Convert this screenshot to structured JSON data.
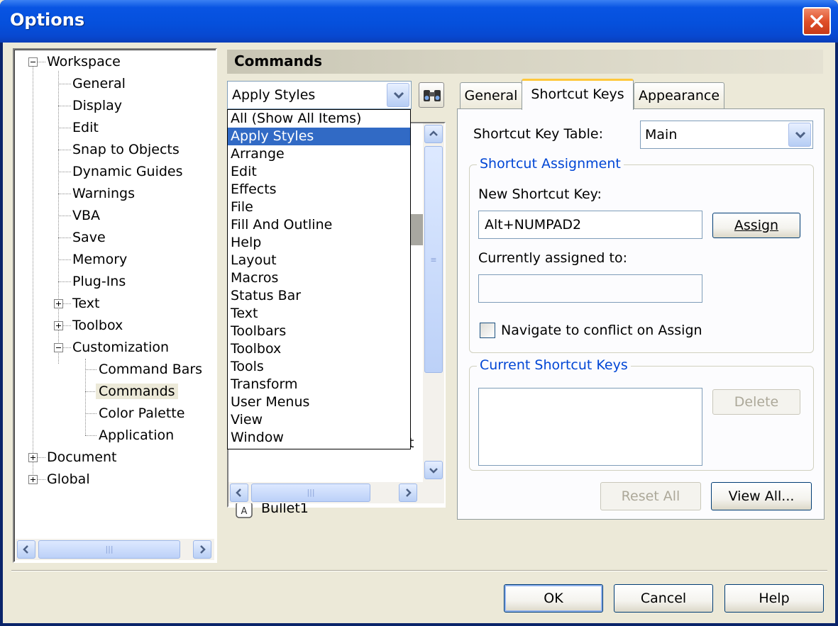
{
  "window": {
    "title": "Options"
  },
  "tree": {
    "items": [
      {
        "label": "Workspace"
      },
      {
        "label": "General"
      },
      {
        "label": "Display"
      },
      {
        "label": "Edit"
      },
      {
        "label": "Snap to Objects"
      },
      {
        "label": "Dynamic Guides"
      },
      {
        "label": "Warnings"
      },
      {
        "label": "VBA"
      },
      {
        "label": "Save"
      },
      {
        "label": "Memory"
      },
      {
        "label": "Plug-Ins"
      },
      {
        "label": "Text"
      },
      {
        "label": "Toolbox"
      },
      {
        "label": "Customization"
      },
      {
        "label": "Command Bars"
      },
      {
        "label": "Commands"
      },
      {
        "label": "Color Palette"
      },
      {
        "label": "Application"
      },
      {
        "label": "Document"
      },
      {
        "label": "Global"
      }
    ]
  },
  "commands": {
    "header": "Commands",
    "category_value": "Apply Styles",
    "dropdown_options": [
      "All (Show All Items)",
      "Apply Styles",
      "Arrange",
      "Edit",
      "Effects",
      "File",
      "Fill And Outline",
      "Help",
      "Layout",
      "Macros",
      "Status Bar",
      "Text",
      "Toolbars",
      "Toolbox",
      "Tools",
      "Transform",
      "User Menus",
      "View",
      "Window"
    ],
    "list_item_partial": "t",
    "list_item": "Bullet1"
  },
  "tabs": [
    "General",
    "Shortcut Keys",
    "Appearance"
  ],
  "shortcut": {
    "table_label": "Shortcut Key Table:",
    "table_value": "Main",
    "assignment_title": "Shortcut Assignment",
    "new_key_label": "New Shortcut Key:",
    "new_key_value": "Alt+NUMPAD2",
    "assign_button": "Assign",
    "assigned_to_label": "Currently assigned to:",
    "assigned_to_value": "",
    "navigate_label": "Navigate to conflict on Assign",
    "current_keys_title": "Current Shortcut Keys",
    "delete_button": "Delete",
    "reset_all_button": "Reset All",
    "view_all_button": "View All..."
  },
  "footer": {
    "ok": "OK",
    "cancel": "Cancel",
    "help": "Help"
  }
}
